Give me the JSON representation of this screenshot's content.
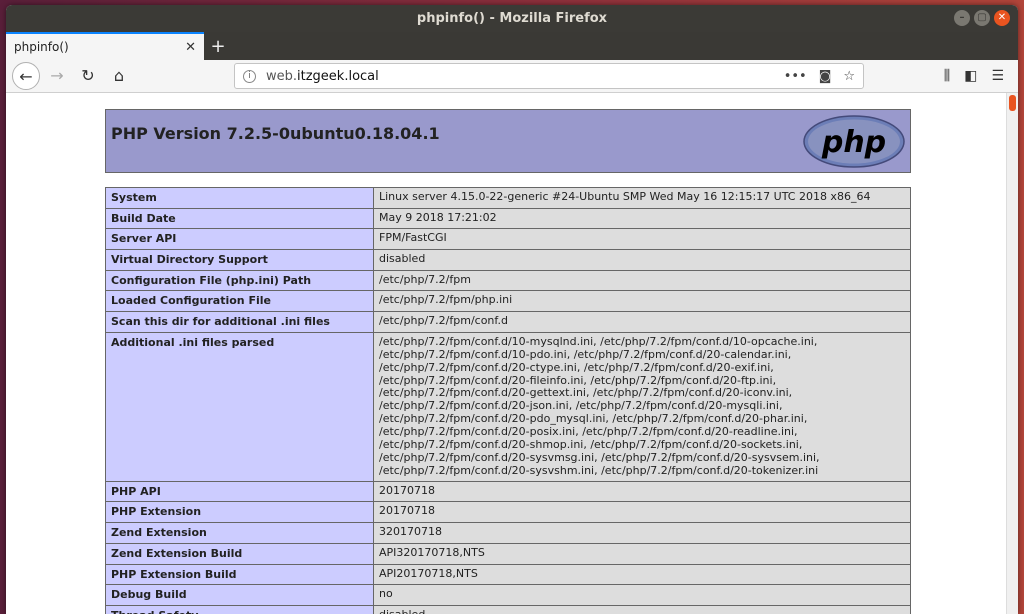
{
  "window": {
    "title": "phpinfo() - Mozilla Firefox"
  },
  "tab": {
    "label": "phpinfo()",
    "close": "✕",
    "new_tab": "+"
  },
  "urlbar": {
    "host_prefix": "web.",
    "host_domain": "itzgeek.local"
  },
  "phpinfo": {
    "version_title": "PHP Version 7.2.5-0ubuntu0.18.04.1",
    "logo_text": "php",
    "rows": [
      {
        "key": "System",
        "value": "Linux server 4.15.0-22-generic #24-Ubuntu SMP Wed May 16 12:15:17 UTC 2018 x86_64"
      },
      {
        "key": "Build Date",
        "value": "May 9 2018 17:21:02"
      },
      {
        "key": "Server API",
        "value": "FPM/FastCGI"
      },
      {
        "key": "Virtual Directory Support",
        "value": "disabled"
      },
      {
        "key": "Configuration File (php.ini) Path",
        "value": "/etc/php/7.2/fpm"
      },
      {
        "key": "Loaded Configuration File",
        "value": "/etc/php/7.2/fpm/php.ini"
      },
      {
        "key": "Scan this dir for additional .ini files",
        "value": "/etc/php/7.2/fpm/conf.d"
      },
      {
        "key": "Additional .ini files parsed",
        "value": "/etc/php/7.2/fpm/conf.d/10-mysqlnd.ini, /etc/php/7.2/fpm/conf.d/10-opcache.ini, /etc/php/7.2/fpm/conf.d/10-pdo.ini, /etc/php/7.2/fpm/conf.d/20-calendar.ini, /etc/php/7.2/fpm/conf.d/20-ctype.ini, /etc/php/7.2/fpm/conf.d/20-exif.ini, /etc/php/7.2/fpm/conf.d/20-fileinfo.ini, /etc/php/7.2/fpm/conf.d/20-ftp.ini, /etc/php/7.2/fpm/conf.d/20-gettext.ini, /etc/php/7.2/fpm/conf.d/20-iconv.ini, /etc/php/7.2/fpm/conf.d/20-json.ini, /etc/php/7.2/fpm/conf.d/20-mysqli.ini, /etc/php/7.2/fpm/conf.d/20-pdo_mysql.ini, /etc/php/7.2/fpm/conf.d/20-phar.ini, /etc/php/7.2/fpm/conf.d/20-posix.ini, /etc/php/7.2/fpm/conf.d/20-readline.ini, /etc/php/7.2/fpm/conf.d/20-shmop.ini, /etc/php/7.2/fpm/conf.d/20-sockets.ini, /etc/php/7.2/fpm/conf.d/20-sysvmsg.ini, /etc/php/7.2/fpm/conf.d/20-sysvsem.ini, /etc/php/7.2/fpm/conf.d/20-sysvshm.ini, /etc/php/7.2/fpm/conf.d/20-tokenizer.ini"
      },
      {
        "key": "PHP API",
        "value": "20170718"
      },
      {
        "key": "PHP Extension",
        "value": "20170718"
      },
      {
        "key": "Zend Extension",
        "value": "320170718"
      },
      {
        "key": "Zend Extension Build",
        "value": "API320170718,NTS"
      },
      {
        "key": "PHP Extension Build",
        "value": "API20170718,NTS"
      },
      {
        "key": "Debug Build",
        "value": "no"
      },
      {
        "key": "Thread Safety",
        "value": "disabled"
      }
    ]
  },
  "colors": {
    "header_bg": "#9999cc",
    "key_bg": "#ccccff",
    "value_bg": "#dddddd",
    "tab_accent": "#0a84ff",
    "close_button": "#e95420"
  }
}
